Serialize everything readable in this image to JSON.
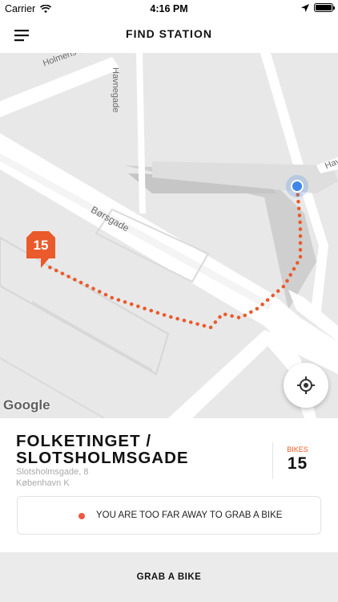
{
  "status_bar": {
    "carrier": "Carrier",
    "time": "4:16 PM"
  },
  "nav": {
    "title": "FIND STATION"
  },
  "map": {
    "street_labels": [
      "Holmens Kanal",
      "Havnegade",
      "Børsgade",
      "Hav"
    ],
    "attribution": "Google",
    "station_marker_count": "15",
    "route_color": "#ea5a2b"
  },
  "station": {
    "name_line1": "FOLKETINGET /",
    "name_line2": "SLOTSHOLMSGADE",
    "address_line1": "Slotsholmsgade, 8",
    "address_line2": "København K",
    "bikes_label": "BIKES",
    "bikes_count": "15"
  },
  "alert": {
    "message": "YOU ARE TOO FAR AWAY TO GRAB A BIKE",
    "dot_color": "#ea5a43"
  },
  "actions": {
    "grab_label": "GRAB A BIKE"
  },
  "colors": {
    "accent": "#f15a22"
  }
}
